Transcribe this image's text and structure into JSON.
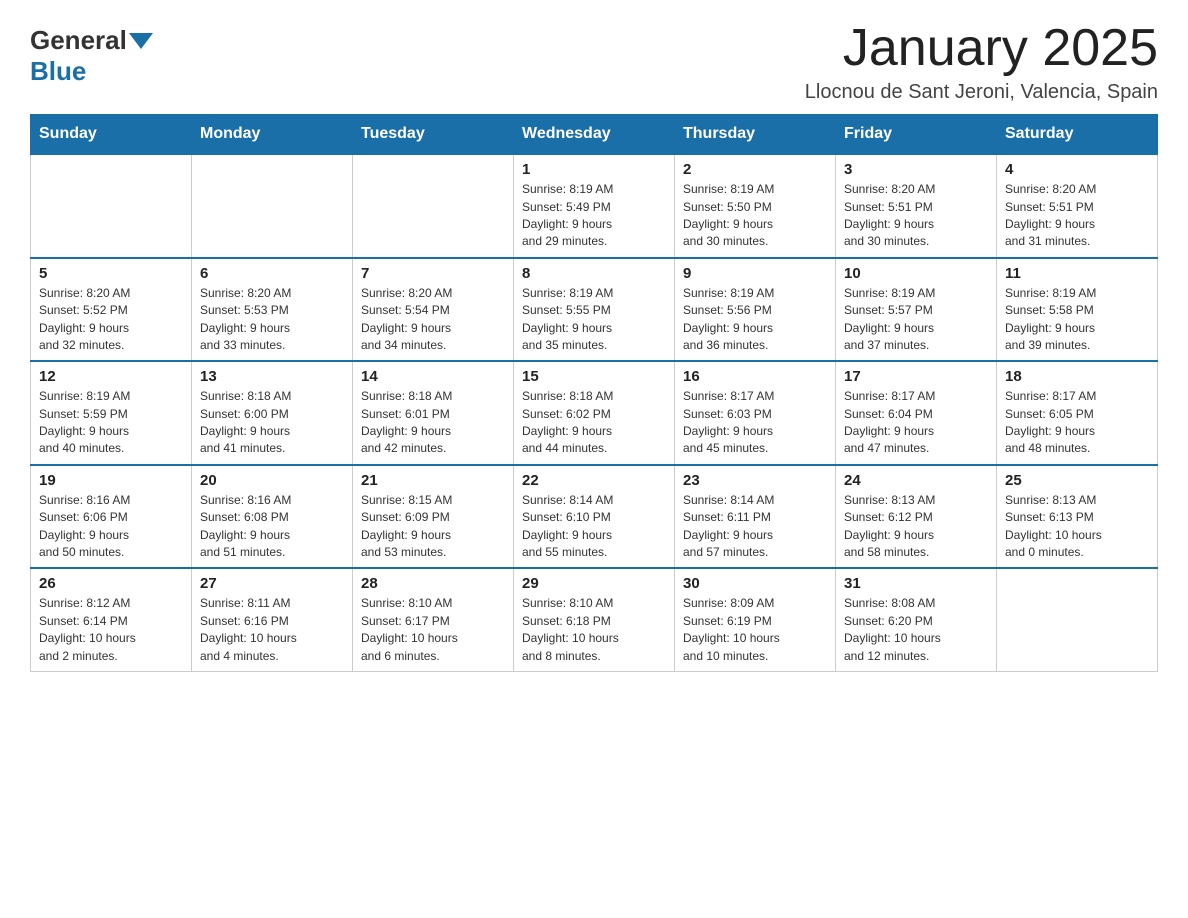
{
  "header": {
    "logo_general": "General",
    "logo_blue": "Blue",
    "month_title": "January 2025",
    "location": "Llocnou de Sant Jeroni, Valencia, Spain"
  },
  "weekdays": [
    "Sunday",
    "Monday",
    "Tuesday",
    "Wednesday",
    "Thursday",
    "Friday",
    "Saturday"
  ],
  "weeks": [
    [
      {
        "day": "",
        "info": ""
      },
      {
        "day": "",
        "info": ""
      },
      {
        "day": "",
        "info": ""
      },
      {
        "day": "1",
        "info": "Sunrise: 8:19 AM\nSunset: 5:49 PM\nDaylight: 9 hours\nand 29 minutes."
      },
      {
        "day": "2",
        "info": "Sunrise: 8:19 AM\nSunset: 5:50 PM\nDaylight: 9 hours\nand 30 minutes."
      },
      {
        "day": "3",
        "info": "Sunrise: 8:20 AM\nSunset: 5:51 PM\nDaylight: 9 hours\nand 30 minutes."
      },
      {
        "day": "4",
        "info": "Sunrise: 8:20 AM\nSunset: 5:51 PM\nDaylight: 9 hours\nand 31 minutes."
      }
    ],
    [
      {
        "day": "5",
        "info": "Sunrise: 8:20 AM\nSunset: 5:52 PM\nDaylight: 9 hours\nand 32 minutes."
      },
      {
        "day": "6",
        "info": "Sunrise: 8:20 AM\nSunset: 5:53 PM\nDaylight: 9 hours\nand 33 minutes."
      },
      {
        "day": "7",
        "info": "Sunrise: 8:20 AM\nSunset: 5:54 PM\nDaylight: 9 hours\nand 34 minutes."
      },
      {
        "day": "8",
        "info": "Sunrise: 8:19 AM\nSunset: 5:55 PM\nDaylight: 9 hours\nand 35 minutes."
      },
      {
        "day": "9",
        "info": "Sunrise: 8:19 AM\nSunset: 5:56 PM\nDaylight: 9 hours\nand 36 minutes."
      },
      {
        "day": "10",
        "info": "Sunrise: 8:19 AM\nSunset: 5:57 PM\nDaylight: 9 hours\nand 37 minutes."
      },
      {
        "day": "11",
        "info": "Sunrise: 8:19 AM\nSunset: 5:58 PM\nDaylight: 9 hours\nand 39 minutes."
      }
    ],
    [
      {
        "day": "12",
        "info": "Sunrise: 8:19 AM\nSunset: 5:59 PM\nDaylight: 9 hours\nand 40 minutes."
      },
      {
        "day": "13",
        "info": "Sunrise: 8:18 AM\nSunset: 6:00 PM\nDaylight: 9 hours\nand 41 minutes."
      },
      {
        "day": "14",
        "info": "Sunrise: 8:18 AM\nSunset: 6:01 PM\nDaylight: 9 hours\nand 42 minutes."
      },
      {
        "day": "15",
        "info": "Sunrise: 8:18 AM\nSunset: 6:02 PM\nDaylight: 9 hours\nand 44 minutes."
      },
      {
        "day": "16",
        "info": "Sunrise: 8:17 AM\nSunset: 6:03 PM\nDaylight: 9 hours\nand 45 minutes."
      },
      {
        "day": "17",
        "info": "Sunrise: 8:17 AM\nSunset: 6:04 PM\nDaylight: 9 hours\nand 47 minutes."
      },
      {
        "day": "18",
        "info": "Sunrise: 8:17 AM\nSunset: 6:05 PM\nDaylight: 9 hours\nand 48 minutes."
      }
    ],
    [
      {
        "day": "19",
        "info": "Sunrise: 8:16 AM\nSunset: 6:06 PM\nDaylight: 9 hours\nand 50 minutes."
      },
      {
        "day": "20",
        "info": "Sunrise: 8:16 AM\nSunset: 6:08 PM\nDaylight: 9 hours\nand 51 minutes."
      },
      {
        "day": "21",
        "info": "Sunrise: 8:15 AM\nSunset: 6:09 PM\nDaylight: 9 hours\nand 53 minutes."
      },
      {
        "day": "22",
        "info": "Sunrise: 8:14 AM\nSunset: 6:10 PM\nDaylight: 9 hours\nand 55 minutes."
      },
      {
        "day": "23",
        "info": "Sunrise: 8:14 AM\nSunset: 6:11 PM\nDaylight: 9 hours\nand 57 minutes."
      },
      {
        "day": "24",
        "info": "Sunrise: 8:13 AM\nSunset: 6:12 PM\nDaylight: 9 hours\nand 58 minutes."
      },
      {
        "day": "25",
        "info": "Sunrise: 8:13 AM\nSunset: 6:13 PM\nDaylight: 10 hours\nand 0 minutes."
      }
    ],
    [
      {
        "day": "26",
        "info": "Sunrise: 8:12 AM\nSunset: 6:14 PM\nDaylight: 10 hours\nand 2 minutes."
      },
      {
        "day": "27",
        "info": "Sunrise: 8:11 AM\nSunset: 6:16 PM\nDaylight: 10 hours\nand 4 minutes."
      },
      {
        "day": "28",
        "info": "Sunrise: 8:10 AM\nSunset: 6:17 PM\nDaylight: 10 hours\nand 6 minutes."
      },
      {
        "day": "29",
        "info": "Sunrise: 8:10 AM\nSunset: 6:18 PM\nDaylight: 10 hours\nand 8 minutes."
      },
      {
        "day": "30",
        "info": "Sunrise: 8:09 AM\nSunset: 6:19 PM\nDaylight: 10 hours\nand 10 minutes."
      },
      {
        "day": "31",
        "info": "Sunrise: 8:08 AM\nSunset: 6:20 PM\nDaylight: 10 hours\nand 12 minutes."
      },
      {
        "day": "",
        "info": ""
      }
    ]
  ]
}
